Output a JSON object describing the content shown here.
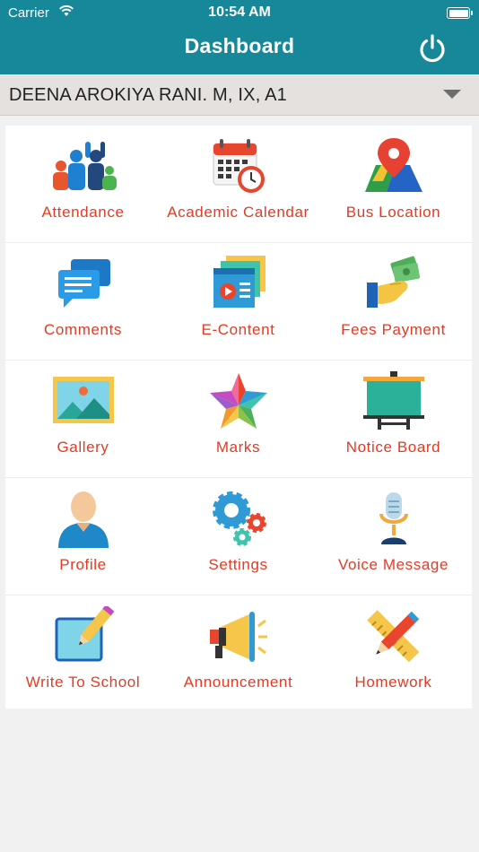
{
  "status": {
    "carrier": "Carrier",
    "time": "10:54 AM"
  },
  "header": {
    "title": "Dashboard"
  },
  "student": {
    "selected": "DEENA AROKIYA RANI.  M, IX, A1"
  },
  "menu": [
    {
      "label": "Attendance",
      "icon": "attendance-icon"
    },
    {
      "label": "Academic Calendar",
      "icon": "calendar-icon"
    },
    {
      "label": "Bus Location",
      "icon": "map-pin-icon"
    },
    {
      "label": "Comments",
      "icon": "chat-bubbles-icon"
    },
    {
      "label": "E-Content",
      "icon": "video-content-icon"
    },
    {
      "label": "Fees Payment",
      "icon": "money-hand-icon"
    },
    {
      "label": "Gallery",
      "icon": "picture-icon"
    },
    {
      "label": "Marks",
      "icon": "star-icon"
    },
    {
      "label": "Notice Board",
      "icon": "board-icon"
    },
    {
      "label": "Profile",
      "icon": "user-icon"
    },
    {
      "label": "Settings",
      "icon": "gears-icon"
    },
    {
      "label": "Voice Message",
      "icon": "microphone-icon"
    },
    {
      "label": "Write To School",
      "icon": "pencil-note-icon"
    },
    {
      "label": "Announcement",
      "icon": "megaphone-icon"
    },
    {
      "label": "Homework",
      "icon": "pencil-ruler-icon"
    }
  ]
}
